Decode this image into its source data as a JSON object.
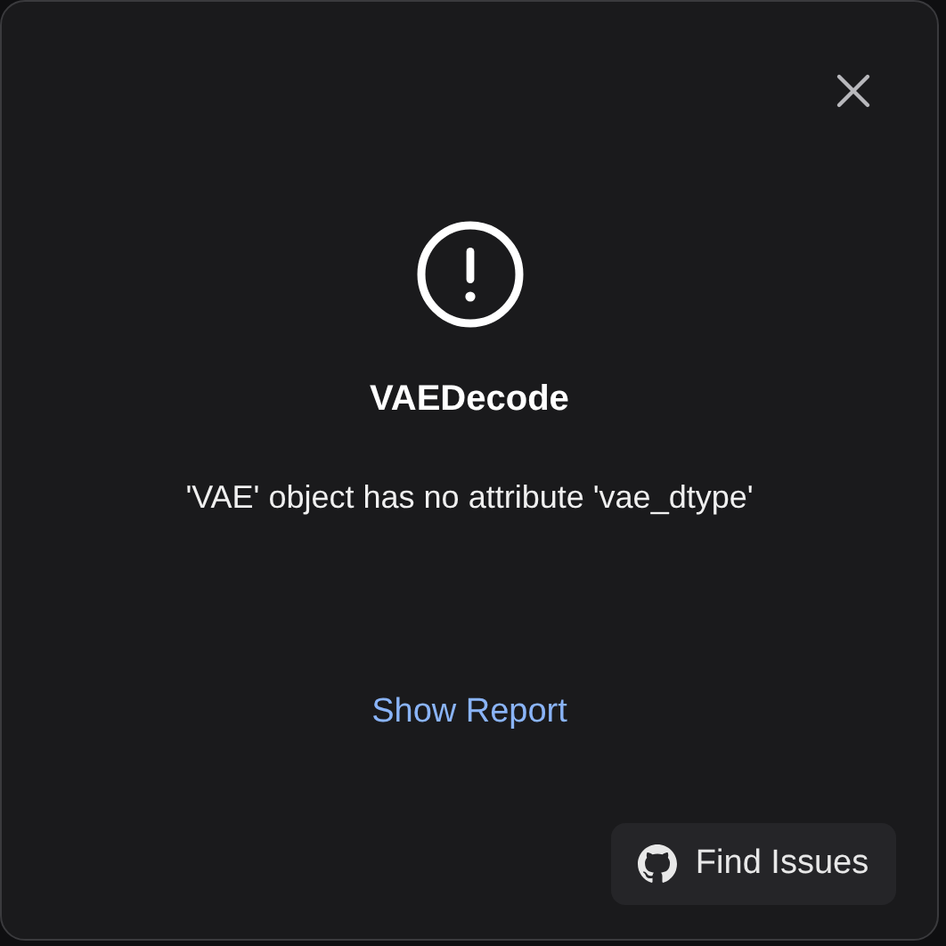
{
  "dialog": {
    "title": "VAEDecode",
    "message": "'VAE' object has no attribute 'vae_dtype'",
    "link": "Show Report",
    "button": "Find Issues"
  }
}
